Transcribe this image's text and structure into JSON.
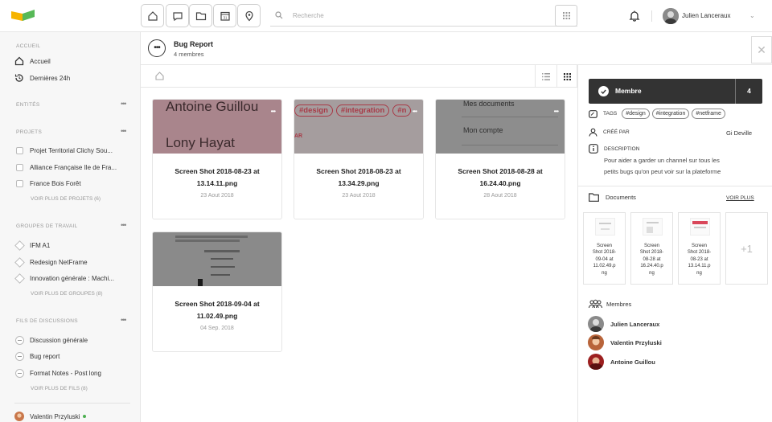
{
  "topbar": {
    "search_placeholder": "Recherche",
    "calendar_day": "31",
    "user_name": "Julien Lanceraux"
  },
  "sidebar": {
    "accueil_label": "ACCUEIL",
    "accueil_items": [
      "Accueil",
      "Dernières 24h"
    ],
    "entites_label": "ENTITÉS",
    "projets_label": "PROJETS",
    "projets": [
      "Projet Territorial Clichy Sou...",
      "Alliance Française Ile de Fra...",
      "France Bois Forêt"
    ],
    "projets_more": "VOIR PLUS DE PROJETS (6)",
    "groupes_label": "GROUPES DE TRAVAIL",
    "groupes": [
      "IFM A1",
      "Redesign NetFrame",
      "Innovation générale : Machi..."
    ],
    "groupes_more": "VOIR PLUS DE GROUPES (8)",
    "fils_label": "FILS DE DISCUSSIONS",
    "fils": [
      "Discussion générale",
      "Bug report",
      "Format Notes - Post long"
    ],
    "fils_more": "VOIR PLUS DE FILS (8)",
    "footer_user": "Valentin Przyluski"
  },
  "channel": {
    "title": "Bug Report",
    "subtitle": "4 membres"
  },
  "files": [
    {
      "title": "Screen Shot 2018-08-23 at 13.14.11.png",
      "date": "23 Aout 2018",
      "preview_lines": [
        "Antoine Guillou",
        "Lony Hayat"
      ]
    },
    {
      "title": "Screen Shot 2018-08-23 at 13.34.29.png",
      "date": "23 Aout 2018",
      "preview_tags": [
        "#design",
        "#integration",
        "#n"
      ],
      "preview_text": "AR"
    },
    {
      "title": "Screen Shot 2018-08-28 at 16.24.40.png",
      "date": "28 Aout 2018",
      "preview_lines": [
        "Mes documents",
        "Mon compte"
      ]
    },
    {
      "title": "Screen Shot 2018-09-04 at 11.02.49.png",
      "date": "04 Sep. 2018"
    }
  ],
  "panel": {
    "member_label": "Membre",
    "member_count": "4",
    "tags_label": "TAGS",
    "tags": [
      "#design",
      "#integration",
      "#netframe"
    ],
    "created_label": "CRÉÉ PAR",
    "creator": "Gi Deville",
    "description_label": "DESCRIPTION",
    "description_lines": [
      "Pour aider a garder un channel sur tous les",
      "petits bugs qu'on peut voir sur la plateforme"
    ],
    "documents_label": "Documents",
    "voir_plus": "VOIR PLUS",
    "docs": [
      [
        "Screen",
        "Shot 2018-",
        "09-04 at",
        "11.02.49.p",
        "ng"
      ],
      [
        "Screen",
        "Shot 2018-",
        "08-28 at",
        "16.24.40.p",
        "ng"
      ],
      [
        "Screen",
        "Shot 2018-",
        "08-23 at",
        "13.14.11.p",
        "ng"
      ]
    ],
    "docs_extra": "+1",
    "members_label": "Membres",
    "members": [
      "Julien Lanceraux",
      "Valentin Przyluski",
      "Antoine Guillou"
    ]
  },
  "colors": {
    "logo_yellow": "#f6b400",
    "logo_green": "#57b957",
    "dark": "#333333",
    "online": "#4caf50"
  }
}
